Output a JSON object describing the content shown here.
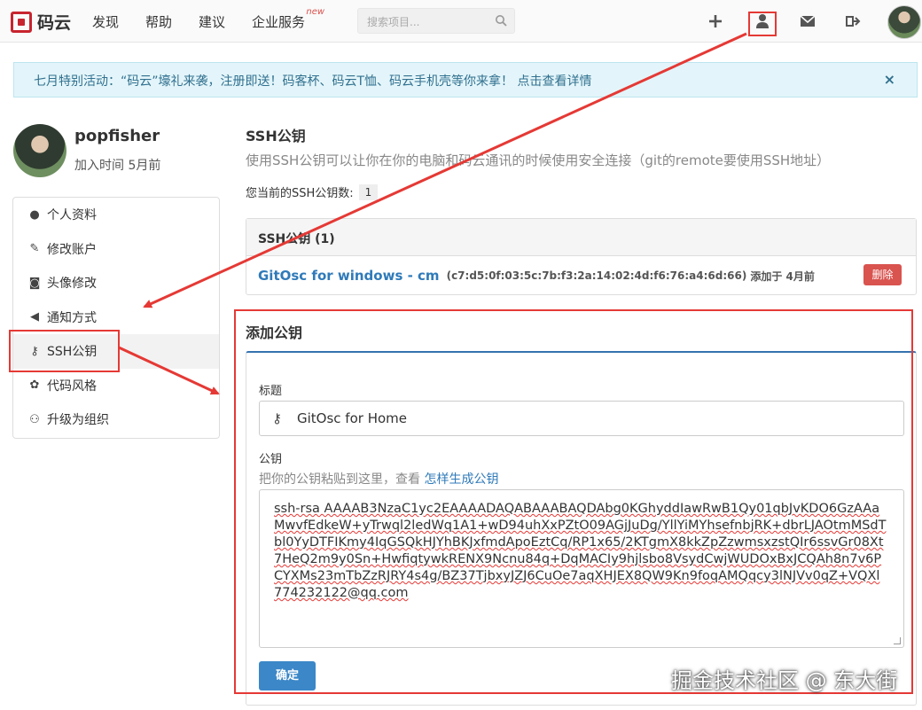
{
  "topbar": {
    "logo_text": "码云",
    "nav": [
      "发现",
      "帮助",
      "建议",
      "企业服务"
    ],
    "new_badge": "new",
    "search_placeholder": "搜索项目..."
  },
  "banner": {
    "text": "七月特别活动：“码云”壕礼来袭，注册即送！码客杯、码云T恤、码云手机壳等你来拿！",
    "link": "点击查看详情",
    "close": "×"
  },
  "profile": {
    "username": "popfisher",
    "joined": "加入时间 5月前"
  },
  "sidebar": {
    "items": [
      {
        "label": "个人资料",
        "icon": "user-icon"
      },
      {
        "label": "修改账户",
        "icon": "pencil-icon"
      },
      {
        "label": "头像修改",
        "icon": "camera-icon"
      },
      {
        "label": "通知方式",
        "icon": "volume-icon"
      },
      {
        "label": "SSH公钥",
        "icon": "key-icon"
      },
      {
        "label": "代码风格",
        "icon": "palette-icon"
      },
      {
        "label": "升级为组织",
        "icon": "users-icon"
      }
    ]
  },
  "main": {
    "heading": "SSH公钥",
    "description": "使用SSH公钥可以让你在你的电脑和码云通讯的时候使用安全连接（git的remote要使用SSH地址）",
    "count_label": "您当前的SSH公钥数:",
    "count_value": "1",
    "keys_header": "SSH公钥 (1)",
    "key": {
      "name": "GitOsc for windows - cm",
      "fingerprint": "(c7:d5:0f:03:5c:7b:f3:2a:14:02:4d:f6:76:a4:6d:66)",
      "added": "添加于 4月前",
      "delete_label": "删除"
    },
    "add": {
      "heading": "添加公钥",
      "title_label": "标题",
      "title_value": "GitOsc for Home",
      "key_label": "公钥",
      "hint": "把你的公钥粘贴到这里，查看",
      "hint_link": "怎样生成公钥",
      "key_value": "ssh-rsa AAAAB3NzaC1yc2EAAAADAQABAAABAQDAbg0KGhyddIawRwB1Qy01qbJvKDO6GzAAaMwvfEdkeW+yTrwql2ledWq1A1+wD94uhXxPZtO09AGjJuDg/YllYiMYhsefnbjRK+dbrLJAOtmMSdTbl0YyDTFIKmy4IqGSQkHJYhBKJxfmdApoEztCq/RP1x65/2KTgmX8kkZpZzwmsxzstQIr6ssvGr08Xt7HeQ2m9y0Sn+HwfiqtywkRENX9Ncnu84q+DqMACIy9hjlsbo8VsydCwjWUDOxBxJCQAh8n7v6PCYXMs23mTbZzRJRY4s4g/BZ37TjbxyJZJ6CuOe7aqXHJEX8QW9Kn9foqAMQqcy3lNJVv0qZ+VQXl 774232122@qq.com",
      "submit_label": "确定"
    }
  },
  "watermark": "掘金技术社区 @ 东大街",
  "colors": {
    "accent_red": "#e53935",
    "link_blue": "#2f7ab9",
    "button_blue": "#3b87c8",
    "banner_bg": "#e3f5fa",
    "danger": "#d9534f"
  }
}
